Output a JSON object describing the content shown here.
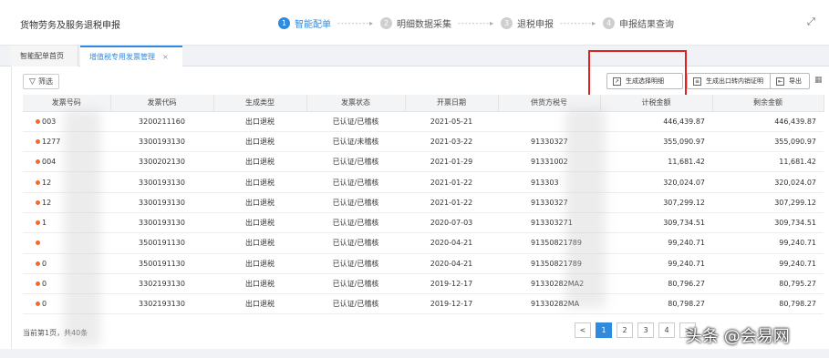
{
  "header": {
    "title": "货物劳务及服务退税申报",
    "steps": [
      {
        "num": "1",
        "label": "智能配单"
      },
      {
        "num": "2",
        "label": "明细数据采集"
      },
      {
        "num": "3",
        "label": "退税申报"
      },
      {
        "num": "4",
        "label": "申报结果查询"
      }
    ],
    "arrow": "---------▸"
  },
  "tabs": [
    {
      "label": "智能配单首页"
    },
    {
      "label": "增值税专用发票管理",
      "close": "×"
    }
  ],
  "toolbar": {
    "filter_label": "筛选",
    "gen_report_label": "生成选择明细",
    "gen_cert_label": "生成出口转内销证明",
    "export_label": "导出"
  },
  "table": {
    "columns": [
      "发票号码",
      "发票代码",
      "生成类型",
      "发票状态",
      "开票日期",
      "供货方税号",
      "计税金额",
      "剩余金额"
    ],
    "rows": [
      [
        "003",
        "3200211160",
        "出口退税",
        "已认证/已稽核",
        "2021-05-21",
        "",
        "446,439.87",
        "446,439.87"
      ],
      [
        "1277",
        "3300193130",
        "出口退税",
        "已认证/未稽核",
        "2021-03-22",
        "91330327",
        "355,090.97",
        "355,090.97"
      ],
      [
        "004",
        "3300202130",
        "出口退税",
        "已认证/已稽核",
        "2021-01-29",
        "91331002",
        "11,681.42",
        "11,681.42"
      ],
      [
        "12",
        "3300193130",
        "出口退税",
        "已认证/已稽核",
        "2021-01-22",
        "913303",
        "320,024.07",
        "320,024.07"
      ],
      [
        "12",
        "3300193130",
        "出口退税",
        "已认证/已稽核",
        "2021-01-22",
        "91330327",
        "307,299.12",
        "307,299.12"
      ],
      [
        "1",
        "3300193130",
        "出口退税",
        "已认证/已稽核",
        "2020-07-03",
        "913303271",
        "309,734.51",
        "309,734.51"
      ],
      [
        "",
        "3500191130",
        "出口退税",
        "已认证/已稽核",
        "2020-04-21",
        "91350821789",
        "99,240.71",
        "99,240.71"
      ],
      [
        "0",
        "3500191130",
        "出口退税",
        "已认证/已稽核",
        "2020-04-21",
        "91350821789",
        "99,240.71",
        "99,240.71"
      ],
      [
        "0",
        "3302193130",
        "出口退税",
        "已认证/已稽核",
        "2019-12-17",
        "91330282MA2",
        "80,796.27",
        "80,795.27"
      ],
      [
        "0",
        "3302193130",
        "出口退税",
        "已认证/已稽核",
        "2019-12-17",
        "91330282MA",
        "80,798.27",
        "80,798.27"
      ]
    ]
  },
  "pagination": {
    "info": "当前第1页，共40条",
    "prev": "<",
    "pages": [
      "1",
      "2",
      "3",
      "4"
    ],
    "next": ">"
  },
  "watermark": "头条 @会易网",
  "colors": {
    "accent": "#2f8bde",
    "highlight": "#e02020",
    "dot": "#f06a2c"
  }
}
